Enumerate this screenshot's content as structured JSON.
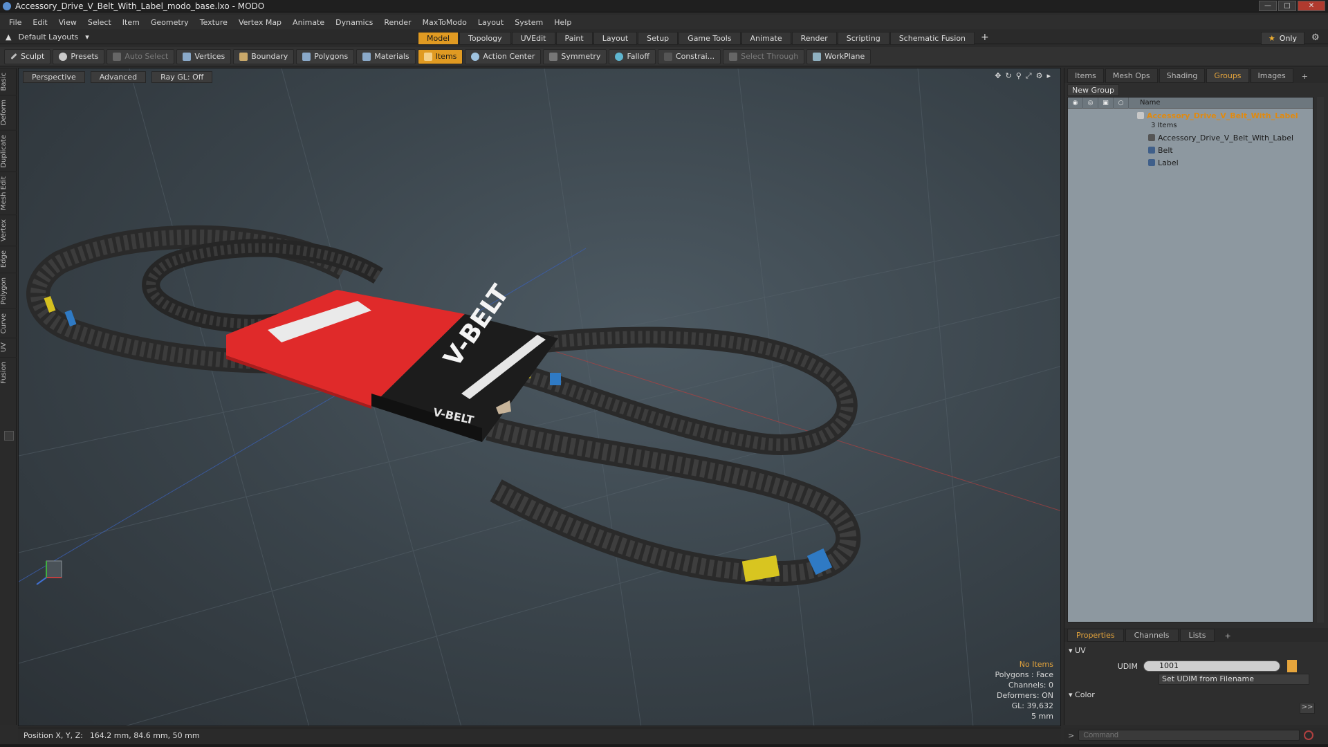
{
  "window": {
    "title": "Accessory_Drive_V_Belt_With_Label_modo_base.lxo - MODO"
  },
  "menu": [
    "File",
    "Edit",
    "View",
    "Select",
    "Item",
    "Geometry",
    "Texture",
    "Vertex Map",
    "Animate",
    "Dynamics",
    "Render",
    "MaxToModo",
    "Layout",
    "System",
    "Help"
  ],
  "layout": {
    "selector": "Default Layouts",
    "tabs": [
      "Model",
      "Topology",
      "UVEdit",
      "Paint",
      "Layout",
      "Setup",
      "Game Tools",
      "Animate",
      "Render",
      "Scripting",
      "Schematic Fusion"
    ],
    "active_tab": "Model",
    "only_label": "Only"
  },
  "toolbar": {
    "sculpt": "Sculpt",
    "presets": "Presets",
    "auto_select": "Auto Select",
    "vertices": "Vertices",
    "boundary": "Boundary",
    "polygons": "Polygons",
    "materials": "Materials",
    "items": "Items",
    "action_center": "Action Center",
    "symmetry": "Symmetry",
    "falloff": "Falloff",
    "constrain": "Constrai...",
    "select_through": "Select Through",
    "workplane": "WorkPlane"
  },
  "left_tabs": [
    "Basic",
    "Deform",
    "Duplicate",
    "Mesh Edit",
    "Vertex",
    "Edge",
    "Polygon",
    "Curve",
    "UV",
    "Fusion"
  ],
  "viewport": {
    "view": "Perspective",
    "shading": "Advanced",
    "raygl": "Ray GL: Off",
    "label_text_1": "V-BELT",
    "label_text_2": "V-BELT",
    "info": {
      "no_items": "No Items",
      "polygons": "Polygons : Face",
      "channels": "Channels: 0",
      "deformers": "Deformers: ON",
      "gl": "GL: 39,632",
      "scale": "5 mm"
    }
  },
  "panel": {
    "tabs": [
      "Items",
      "Mesh Ops",
      "Shading",
      "Groups",
      "Images"
    ],
    "active_tab": "Groups",
    "new_group": "New Group",
    "column_name": "Name",
    "group_name": "Accessory_Drive_V_Belt_With_Label",
    "group_count": "3 Items",
    "items": [
      "Accessory_Drive_V_Belt_With_Label",
      "Belt",
      "Label"
    ]
  },
  "properties": {
    "tabs": [
      "Properties",
      "Channels",
      "Lists"
    ],
    "active_tab": "Properties",
    "section_uv": "UV",
    "udim_label": "UDIM",
    "udim_value": "1001",
    "set_udim": "Set UDIM from Filename",
    "section_color": "Color"
  },
  "status": {
    "position_label": "Position X, Y, Z:",
    "position_value": "164.2 mm, 84.6 mm, 50 mm"
  },
  "command": {
    "placeholder": "Command"
  },
  "colors": {
    "accent": "#e09a22",
    "label_red": "#e02a2a",
    "label_black": "#1c1c1c",
    "group_orange": "#e08a10"
  }
}
